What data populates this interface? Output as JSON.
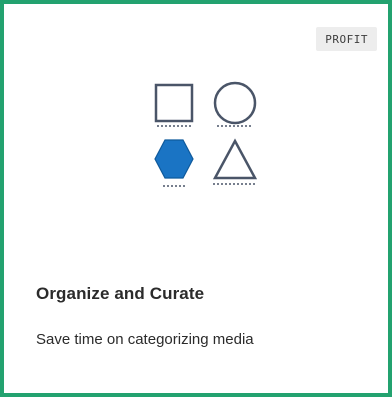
{
  "card": {
    "badge": "PROFIT",
    "title": "Organize and Curate",
    "description": "Save time on categorizing media",
    "border_color": "#23a26f",
    "accent_color": "#1a74c4",
    "illustration_icons": [
      "square-icon",
      "circle-icon",
      "hexagon-icon",
      "triangle-icon"
    ]
  }
}
